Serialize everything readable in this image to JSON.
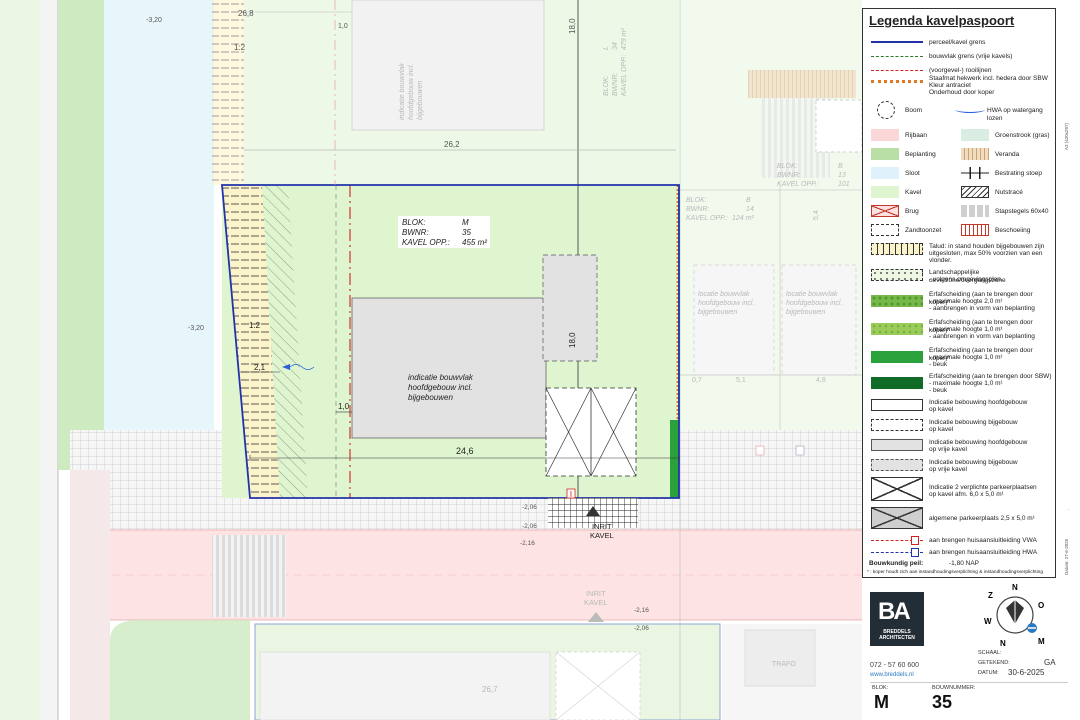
{
  "colors": {
    "kavel": "#dff5d0",
    "groen": "#cdeac0",
    "rijbaan": "#fbd6d8",
    "bouwvlak": "#e2e2e2",
    "perceel": "#2233aa",
    "rooilijn": "#d22222",
    "hekwerk": "#e07a22",
    "haag": "#2aa13a"
  },
  "map": {
    "dims": {
      "d26_8": "26,8",
      "d1_2": "1:2",
      "d1_0_top": "1,0",
      "d18_0_top": "18,0",
      "d26_2": "26,2",
      "d18_0": "18,0",
      "d1_2_slope": "1:2",
      "d2_1": "2,1",
      "d1_0": "1,0",
      "d24_6": "24,6",
      "d0_7": "0,7",
      "d5_1": "5,1",
      "d4_8": "4,8",
      "d5_4": "5,4",
      "d26_7": "26,7"
    },
    "levels": {
      "l320a": "-3,20",
      "l320b": "-3,20",
      "l206a": "-2,06",
      "l206b": "-2,06",
      "l216a": "-2,16",
      "l216b": "-2,16",
      "l206c": "-2,06"
    },
    "lot": {
      "blok_label": "BLOK:",
      "blok_value": "M",
      "bwnr_label": "BWNR:",
      "bwnr_value": "35",
      "opp_label": "KAVEL OPP.:",
      "opp_value": "455 m²",
      "bouwvlak_line1": "indicatie bouwvlak",
      "bouwvlak_line2": "hoofdgebouw incl.",
      "bouwvlak_line3": "bijgebouwen"
    },
    "inrit1_a": "INRIT",
    "inrit1_b": "KAVEL",
    "inrit2_a": "INRIT",
    "inrit2_b": "KAVEL",
    "ghost": {
      "top_line1": "indicatie bouwvlak",
      "top_line2": "hoofdgebouw incl.",
      "top_line3": "bijgebouwen",
      "top_rot_1": "BLOK:",
      "top_rot_2": "BWNR:",
      "top_rot_3": "KAVEL OPP.:",
      "top_rot_v1": "L",
      "top_rot_v2": "34",
      "top_rot_v3": "479 m²",
      "r1_a": "BLOK:",
      "r1_b": "BWNR:",
      "r1_c": "KAVEL OPP.:",
      "r1_va": "B",
      "r1_vb": "13",
      "r1_vc": "101",
      "r2_a": "BLOK:",
      "r2_b": "BWNR:",
      "r2_c": "KAVEL OPP.:",
      "r2_va": "B",
      "r2_vb": "14",
      "r2_vc": "124 m²",
      "loc1_1": "locatie bouwvlak",
      "loc1_2": "hoofdgebouw incl.",
      "loc1_3": "bijgebouwen",
      "loc2_1": "locatie bouwvlak",
      "loc2_2": "hoofdgebouw incl.",
      "loc2_3": "bijgebouwen",
      "trafo": "TRAFO",
      "a3": "A3 (420x297)",
      "datum_side": "Datum: 27-6-2025",
      "side_note": "."
    }
  },
  "legend": {
    "title": "Legenda kavelpaspoort",
    "items": {
      "perceel": "perceel/kavel grens",
      "bouwvlak": "bouwvlak grens (vrije kavels)",
      "rooilijn": "(voorgevel-) rooilijnen",
      "hekwerk1": "Staafmat hekwerk incl. hedera door SBW",
      "hekwerk2": "Kleur antraciet",
      "hekwerk3": "Onderhoud door koper",
      "boom": "Boom",
      "hwa": "HWA op watergang lozen",
      "rijbaan": "Rijbaan",
      "groenstrook": "Groenstrook (gras)",
      "beplanting": "Beplanting",
      "veranda": "Veranda",
      "sloot": "Sloot",
      "bestrating": "Bestrating stoep",
      "kavel": "Kavel",
      "nutstrace": "Nutstracé",
      "brug": "Brug",
      "stapstegels": "Stapstegels 60x40",
      "zandtoonzet": "Zandtoonzet",
      "beschoeiing": "Beschoeiing",
      "talud1": "Talud: in stand houden bijgebouwen zijn",
      "talud2": "uitgesloten, max 50% voorzien van een",
      "talud3": "vlonder.",
      "overgang1": "Landschappelijke oeverzone/overgangszone",
      "overgang2": "- volgens omgevingsplan",
      "erf1a": "Erfafscheiding (aan te brengen door koper)*",
      "erf1b": "- maximale hoogte 2,0 m¹",
      "erf1c": "- aanbrengen in vorm van beplanting",
      "erf2a": "Erfafscheiding (aan te brengen door koper)*",
      "erf2b": "- maximale hoogte 1,0 m¹",
      "erf2c": "- aanbrengen in vorm van beplanting",
      "erf3a": "Erfafscheiding (aan te brengen door koper)*",
      "erf3b": "- maximale hoogte 1,0 m¹",
      "erf3c": "- beuk",
      "erf4a": "Erfafscheiding (aan te brengen door SBW)",
      "erf4b": "- maximale hoogte 1,0 m¹",
      "erf4c": "- beuk",
      "hoofd1a": "Indicatie bebouwing hoofdgebouw",
      "hoofd1b": "op kavel",
      "bij1a": "Indicatie bebouwing bijgebouw",
      "bij1b": "op kavel",
      "hoofd2a": "Indicatie bebouwing hoofdgebouw",
      "hoofd2b": "op vrije kavel",
      "bij2a": "Indicatie bebouwing bijgebouw",
      "bij2b": "op vrije kavel",
      "parkeer1a": "Indicatie 2 verplichte parkeerplaatsen",
      "parkeer1b": "op kavel afm. 6,0 x 5,0 m¹",
      "parkeer2": "algemene parkeerplaats 2,5 x 5,0 m¹",
      "vwa": "aan brengen huisaansluitleiding VWA",
      "hwa2": "aan brengen huisaansluitleiding HWA",
      "peil_label": "Bouwkundig peil:",
      "peil_value": "-1,80 NAP",
      "footnote": "* : koper houdt zich aan instandhoudingsverplichting & instandhoudingsverplichting"
    }
  },
  "titleblock": {
    "logo_mark": "BA",
    "logo_name1": "BREDDELS",
    "logo_name2": "ARCHITECTEN",
    "schaal_label": "SCHAAL:",
    "getekend_label": "GETEKEND:",
    "getekend_value": "GA",
    "datum_label": "DATUM:",
    "datum_value": "30-6-2025",
    "phone": "072 - 57 60 600",
    "web": "www.breddels.nl",
    "blok_label": "BLOK:",
    "blok_value": "M",
    "bouw_label": "BOUWNUMMER:",
    "bouw_value": "35",
    "compass": {
      "n1": "N",
      "o": "O",
      "z": "Z",
      "w": "W",
      "n2": "N",
      "m": "M"
    }
  }
}
